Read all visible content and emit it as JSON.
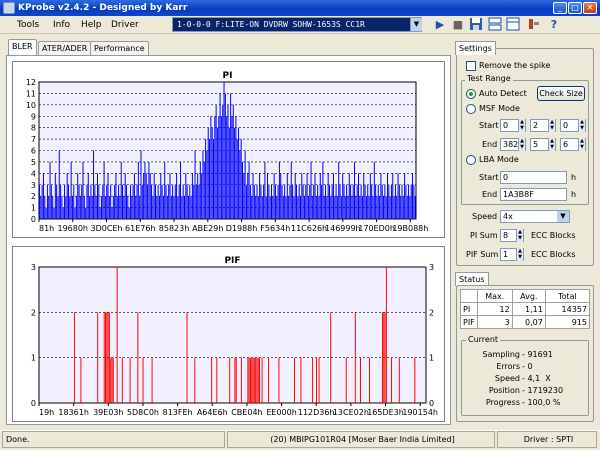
{
  "window": {
    "title": "KProbe v2.4.2 - Designed by Karr"
  },
  "menu": [
    "Tools",
    "Info",
    "Help",
    "Driver"
  ],
  "drive": {
    "selected": "1-0-0-0 F:LITE-ON DVDRW SOHW-1653S CC1R"
  },
  "tabs": [
    "BLER",
    "ATER/ADER",
    "Performance"
  ],
  "settings": {
    "title": "Settings",
    "remove_spike": "Remove the spike",
    "test_range": "Test Range",
    "auto_detect": "Auto Detect",
    "check_size": "Check Size",
    "msf_mode": "MSF Mode",
    "start": "Start",
    "end": "End",
    "msf_start": [
      "0",
      "2",
      "0"
    ],
    "msf_end": [
      "382",
      "5",
      "6"
    ],
    "lba_mode": "LBA Mode",
    "lba_start": "0",
    "lba_end": "1A3B8F",
    "unit_h": "h",
    "speed_label": "Speed",
    "speed_value": "4x",
    "pi_sum_label": "PI Sum",
    "pi_sum_value": "8",
    "pif_sum_label": "PIF Sum",
    "pif_sum_value": "1",
    "ecc_blocks": "ECC Blocks"
  },
  "status": {
    "title": "Status",
    "headers": [
      "Max.",
      "Avg.",
      "Total"
    ],
    "rows": [
      {
        "label": "PI",
        "max": "12",
        "avg": "1,11",
        "total": "14357"
      },
      {
        "label": "PIF",
        "max": "3",
        "avg": "0,07",
        "total": "915"
      }
    ],
    "current_title": "Current",
    "current": [
      {
        "label": "Sampling",
        "value": "91691"
      },
      {
        "label": "Errors",
        "value": "0"
      },
      {
        "label": "Speed",
        "value": "4,1  X"
      },
      {
        "label": "Position",
        "value": "1719230"
      },
      {
        "label": "Progress",
        "value": "100,0 %"
      }
    ]
  },
  "statusbar": {
    "left": "Done.",
    "middle": "(20) MBIPG101R04 [Moser Baer India Limited]",
    "right": "Driver : SPTI"
  },
  "colors": {
    "pi_bars": "#0000ff",
    "pif_bars": "#ff0000",
    "plot_bg": "#f0f0ff",
    "selection": "#0a246a"
  },
  "icons": [
    "app-icon",
    "play-icon",
    "stop-icon",
    "save-icon",
    "dual-graph-icon",
    "single-graph-icon",
    "settings-icon",
    "help-icon"
  ],
  "chart_data": [
    {
      "type": "bar",
      "title": "PI",
      "ylim": [
        0,
        12
      ],
      "yticks": [
        0,
        1,
        2,
        3,
        4,
        5,
        6,
        7,
        8,
        9,
        10,
        11,
        12
      ],
      "xticklabels": [
        "81h",
        "19680h",
        "3D0CEh",
        "61E76h",
        "85823h",
        "ABE29h",
        "D1988h",
        "F5634h",
        "11C626h",
        "146999h",
        "170ED0h",
        "19B088h"
      ],
      "grid": true,
      "values": [
        3,
        2,
        3,
        4,
        2,
        1,
        3,
        2,
        5,
        3,
        2,
        1,
        4,
        3,
        2,
        6,
        3,
        2,
        1,
        3,
        2,
        4,
        3,
        2,
        5,
        2,
        3,
        1,
        2,
        4,
        3,
        2,
        3,
        5,
        2,
        1,
        3,
        4,
        2,
        3,
        2,
        6,
        3,
        2,
        4,
        3,
        1,
        2,
        3,
        5,
        2,
        3,
        4,
        2,
        3,
        1,
        2,
        3,
        4,
        2,
        3,
        2,
        5,
        3,
        2,
        4,
        3,
        2,
        1,
        3,
        2,
        3,
        4,
        2,
        3,
        5,
        2,
        6,
        3,
        4,
        5,
        4,
        3,
        5,
        4,
        3,
        2,
        4,
        3,
        2,
        3,
        2,
        4,
        3,
        2,
        5,
        3,
        2,
        3,
        4,
        2,
        3,
        2,
        3,
        4,
        2,
        3,
        5,
        2,
        3,
        2,
        4,
        3,
        2,
        3,
        2,
        4,
        3,
        6,
        3,
        4,
        3,
        5,
        4,
        6,
        5,
        7,
        6,
        8,
        7,
        9,
        8,
        7,
        9,
        10,
        8,
        9,
        11,
        9,
        10,
        12,
        11,
        9,
        10,
        8,
        11,
        9,
        10,
        8,
        9,
        7,
        8,
        6,
        7,
        5,
        4,
        6,
        3,
        4,
        5,
        3,
        2,
        4,
        3,
        2,
        3,
        2,
        4,
        3,
        2,
        3,
        5,
        2,
        4,
        3,
        2,
        3,
        2,
        4,
        3,
        2,
        3,
        5,
        4,
        3,
        2,
        3,
        2,
        4,
        2,
        3,
        5,
        3,
        2,
        4,
        3,
        2,
        3,
        2,
        4,
        3,
        2,
        3,
        4,
        2,
        3,
        5,
        2,
        3,
        4,
        2,
        3,
        2,
        4,
        3,
        5,
        2,
        3,
        2,
        4,
        3,
        2,
        3,
        4,
        2,
        3,
        2,
        5,
        3,
        2,
        4,
        3,
        2,
        3,
        2,
        4,
        3,
        2,
        3,
        5,
        2,
        3,
        4,
        2,
        3,
        2,
        4,
        3,
        2,
        3,
        2,
        4,
        3,
        2,
        5,
        3,
        2,
        3,
        2,
        4,
        3,
        2,
        3,
        2,
        4,
        3,
        2,
        3,
        4,
        2,
        3,
        2,
        4,
        3,
        2,
        3,
        2,
        4,
        3,
        2,
        3,
        2,
        3,
        4,
        3,
        2
      ]
    },
    {
      "type": "bar",
      "title": "PIF",
      "ylim": [
        0,
        3
      ],
      "yticks": [
        0,
        1,
        2,
        3
      ],
      "xticklabels": [
        "19h",
        "18361h",
        "39E03h",
        "5D8C0h",
        "813FEh",
        "A64E6h",
        "CBE04h",
        "EE000h",
        "112D36h",
        "13CE02h",
        "165DE3h",
        "190154h"
      ],
      "grid": true,
      "values": [
        0,
        0,
        0,
        0,
        0,
        0,
        0,
        0,
        0,
        0,
        0,
        0,
        0,
        0,
        0,
        0,
        0,
        0,
        0,
        0,
        0,
        0,
        0,
        0,
        0,
        0,
        0,
        2,
        0,
        0,
        0,
        0,
        1,
        0,
        0,
        0,
        0,
        0,
        0,
        0,
        0,
        0,
        0,
        0,
        0,
        2,
        0,
        0,
        0,
        0,
        2,
        2,
        2,
        2,
        2,
        1,
        1,
        1,
        0,
        0,
        3,
        0,
        0,
        0,
        1,
        0,
        0,
        0,
        0,
        0,
        1,
        0,
        0,
        0,
        0,
        0,
        2,
        0,
        0,
        0,
        1,
        0,
        0,
        0,
        0,
        0,
        0,
        1,
        0,
        0,
        0,
        0,
        0,
        0,
        0,
        0,
        0,
        0,
        0,
        0,
        0,
        0,
        0,
        0,
        0,
        0,
        0,
        0,
        0,
        0,
        0,
        0,
        0,
        0,
        2,
        0,
        0,
        0,
        0,
        0,
        1,
        0,
        0,
        0,
        0,
        0,
        0,
        0,
        0,
        0,
        0,
        0,
        0,
        1,
        0,
        0,
        0,
        1,
        0,
        0,
        0,
        0,
        0,
        0,
        0,
        0,
        0,
        1,
        0,
        0,
        0,
        1,
        1,
        0,
        0,
        0,
        1,
        0,
        0,
        0,
        0,
        1,
        1,
        1,
        1,
        1,
        1,
        1,
        1,
        1,
        1,
        0,
        1,
        0,
        0,
        0,
        0,
        1,
        0,
        0,
        0,
        0,
        0,
        0,
        0,
        1,
        0,
        0,
        0,
        0,
        0,
        0,
        0,
        0,
        0,
        0,
        0,
        1,
        0,
        0,
        0,
        0,
        1,
        0,
        0,
        0,
        0,
        0,
        0,
        0,
        0,
        1,
        0,
        0,
        1,
        0,
        1,
        0,
        0,
        0,
        0,
        0,
        0,
        0,
        0,
        2,
        0,
        0,
        0,
        0,
        0,
        0,
        0,
        0,
        0,
        0,
        0,
        1,
        0,
        0,
        0,
        0,
        0,
        0,
        2,
        0,
        0,
        0,
        1,
        0,
        0,
        0,
        0,
        0,
        0,
        1,
        0,
        0,
        0,
        0,
        0,
        0,
        0,
        0,
        0,
        2,
        2,
        2,
        3,
        0,
        0,
        0,
        1,
        0,
        0,
        0,
        0,
        0,
        1,
        0,
        0,
        0,
        0,
        0,
        0,
        0,
        0,
        0,
        0,
        0,
        1,
        0,
        0,
        0,
        0,
        0,
        0,
        0,
        0
      ]
    }
  ]
}
